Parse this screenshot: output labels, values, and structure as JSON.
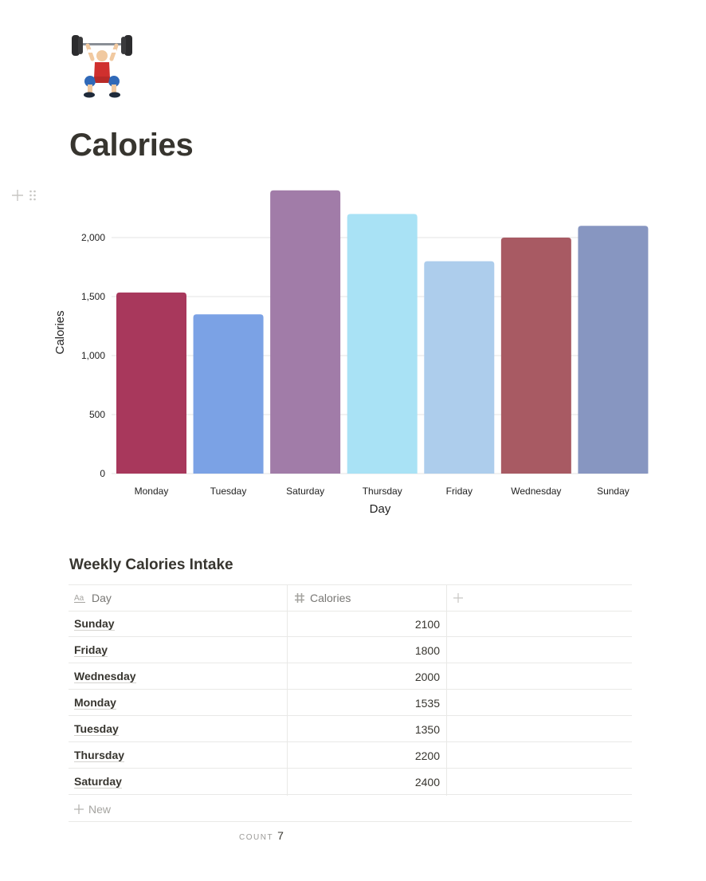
{
  "page": {
    "icon": "weight-lifter-emoji",
    "title": "Calories"
  },
  "block_controls": {
    "add_icon": "plus-icon",
    "drag_icon": "drag-handle-icon"
  },
  "chart_data": {
    "type": "bar",
    "title": "",
    "xlabel": "Day",
    "ylabel": "Calories",
    "categories": [
      "Monday",
      "Tuesday",
      "Saturday",
      "Thursday",
      "Friday",
      "Wednesday",
      "Sunday"
    ],
    "values": [
      1535,
      1350,
      2400,
      2200,
      1800,
      2000,
      2100
    ],
    "colors": [
      "#a8385c",
      "#7ba2e5",
      "#a17ca8",
      "#a9e2f5",
      "#adcdec",
      "#a85a63",
      "#8796c1"
    ],
    "ylim": [
      0,
      2400
    ],
    "yticks": [
      0,
      500,
      1000,
      1500,
      2000
    ],
    "ytick_labels": [
      "0",
      "500",
      "1,000",
      "1,500",
      "2,000"
    ],
    "grid": true,
    "legend": "none"
  },
  "table": {
    "title": "Weekly Calories Intake",
    "columns": [
      {
        "icon": "text-property-icon",
        "label": "Day"
      },
      {
        "icon": "number-property-icon",
        "label": "Calories"
      }
    ],
    "add_column_icon": "plus-icon",
    "rows": [
      {
        "day": "Sunday",
        "calories": "2100"
      },
      {
        "day": "Friday",
        "calories": "1800"
      },
      {
        "day": "Wednesday",
        "calories": "2000"
      },
      {
        "day": "Monday",
        "calories": "1535"
      },
      {
        "day": "Tuesday",
        "calories": "1350"
      },
      {
        "day": "Thursday",
        "calories": "2200"
      },
      {
        "day": "Saturday",
        "calories": "2400"
      }
    ],
    "new_label": "New",
    "count_label": "COUNT",
    "count_value": "7"
  }
}
